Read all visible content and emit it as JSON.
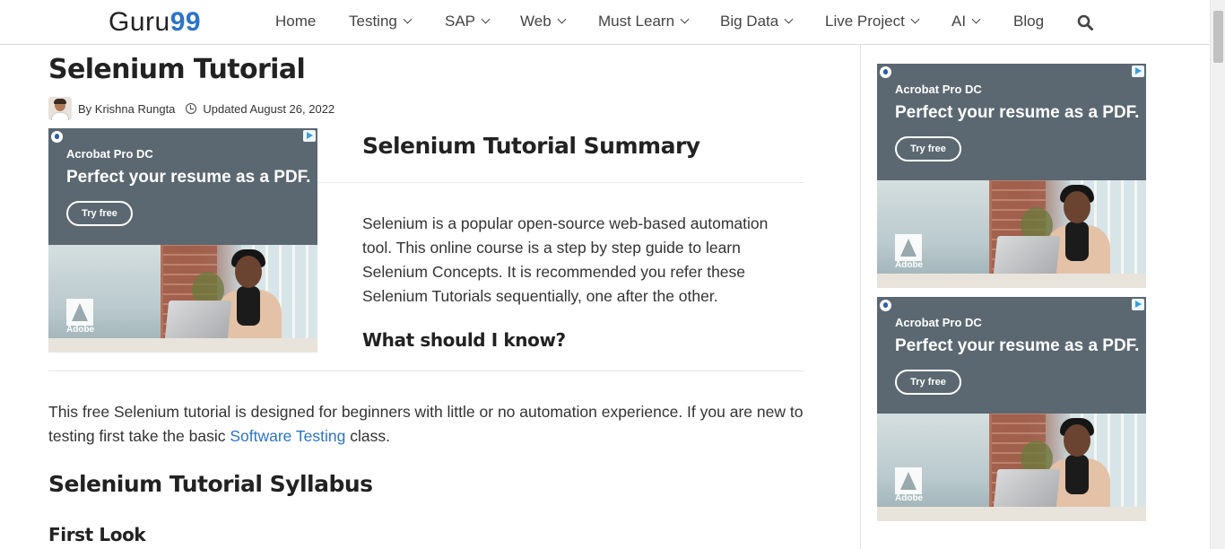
{
  "header": {
    "logo_text": "Guru",
    "logo_number": "99",
    "nav": [
      {
        "label": "Home",
        "dropdown": false
      },
      {
        "label": "Testing",
        "dropdown": true
      },
      {
        "label": "SAP",
        "dropdown": true
      },
      {
        "label": "Web",
        "dropdown": true
      },
      {
        "label": "Must Learn",
        "dropdown": true
      },
      {
        "label": "Big Data",
        "dropdown": true
      },
      {
        "label": "Live Project",
        "dropdown": true
      },
      {
        "label": "AI",
        "dropdown": true
      },
      {
        "label": "Blog",
        "dropdown": false
      }
    ],
    "search_icon": "search-icon"
  },
  "article": {
    "title": "Selenium Tutorial",
    "author_prefix": "By ",
    "author": "Krishna Rungta",
    "updated": "Updated August 26, 2022",
    "summary_title": "Selenium Tutorial Summary",
    "summary_text": "Selenium is a popular open-source web-based automation tool. This online course is a step by step guide to learn Selenium Concepts. It is recommended you refer these Selenium Tutorials sequentially, one after the other.",
    "know_title": "What should I know?",
    "intro_before": "This free Selenium tutorial is designed for beginners with little or no automation experience. If you are new to testing first take the basic ",
    "intro_link": "Software Testing",
    "intro_after": " class.",
    "syllabus_title": "Selenium Tutorial Syllabus",
    "first_look": "First Look"
  },
  "ad": {
    "brand": "Acrobat Pro DC",
    "headline": "Perfect your resume as a PDF.",
    "button": "Try free",
    "logo_text": "Adobe",
    "colors": {
      "panel": "#5b6872",
      "link": "#2b74c7"
    }
  }
}
